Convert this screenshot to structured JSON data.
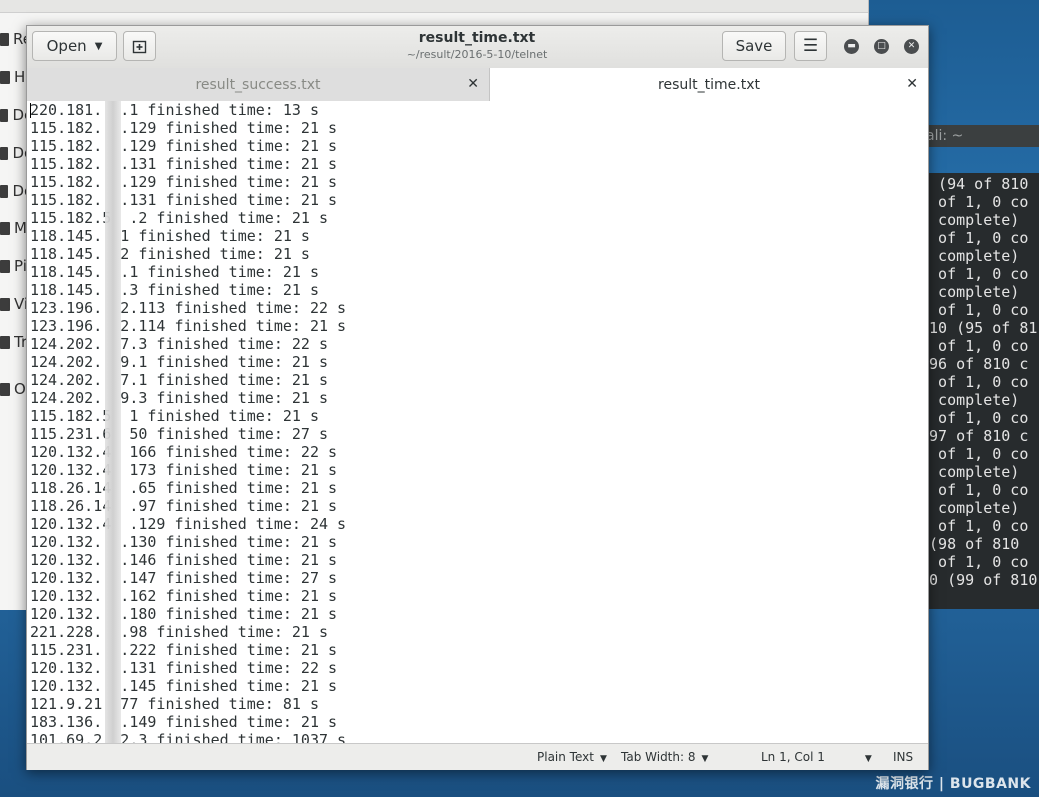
{
  "file_manager": {
    "sidebar_items": [
      {
        "label": "Re",
        "icon": "clock-icon"
      },
      {
        "label": "H",
        "icon": "home-icon"
      },
      {
        "label": "De",
        "icon": "desktop-icon"
      },
      {
        "label": "Do",
        "icon": "document-icon"
      },
      {
        "label": "Do",
        "icon": "download-icon"
      },
      {
        "label": "M",
        "icon": "music-icon"
      },
      {
        "label": "Pi",
        "icon": "picture-icon"
      },
      {
        "label": "Vi",
        "icon": "video-icon"
      },
      {
        "label": "Tr",
        "icon": "trash-icon"
      },
      {
        "label": "O",
        "icon": "plus-icon"
      }
    ]
  },
  "terminal": {
    "title": "ali: ~",
    "lines": [
      "4 (94 of 810",
      "1 of 1, 0 co",
      "0 complete)",
      "1 of 1, 0 co",
      "0 complete)",
      "1 of 1, 0 co",
      "0 complete)",
      "1 of 1, 0 co",
      "810 (95 of 81",
      "1 of 1, 0 co",
      "(96 of 810 c",
      "1 of 1, 0 co",
      "0 complete)",
      "1 of 1, 0 co",
      "(97 of 810 c",
      "1 of 1, 0 co",
      "0 complete)",
      "1 of 1, 0 co",
      "0 complete)",
      "1 of 1, 0 co",
      " (98 of 810",
      "1 of 1, 0 co",
      "20 (99 of 810"
    ]
  },
  "watermark": "漏洞银行 | BUGBANK",
  "gedit": {
    "open_label": "Open",
    "save_label": "Save",
    "title": "result_time.txt",
    "subtitle": "~/result/2016-5-10/telnet",
    "tabs": [
      {
        "label": "result_success.txt",
        "active": false
      },
      {
        "label": "result_time.txt",
        "active": true
      }
    ],
    "lines": [
      "220.181.  .1 finished time: 13 s",
      "115.182.  .129 finished time: 21 s",
      "115.182.  .129 finished time: 21 s",
      "115.182.  .131 finished time: 21 s",
      "115.182.  .129 finished time: 21 s",
      "115.182.  .131 finished time: 21 s",
      "115.182.5  .2 finished time: 21 s",
      "118.145.  1 finished time: 21 s",
      "118.145.  2 finished time: 21 s",
      "118.145.  .1 finished time: 21 s",
      "118.145.  .3 finished time: 21 s",
      "123.196.  2.113 finished time: 22 s",
      "123.196.  2.114 finished time: 21 s",
      "124.202.  7.3 finished time: 22 s",
      "124.202.  9.1 finished time: 21 s",
      "124.202.  7.1 finished time: 21 s",
      "124.202.  9.3 finished time: 21 s",
      "115.182.5  1 finished time: 21 s",
      "115.231.6  50 finished time: 27 s",
      "120.132.4  166 finished time: 22 s",
      "120.132.4  173 finished time: 21 s",
      "118.26.14  .65 finished time: 21 s",
      "118.26.14  .97 finished time: 21 s",
      "120.132.4  .129 finished time: 24 s",
      "120.132.  .130 finished time: 21 s",
      "120.132.  .146 finished time: 21 s",
      "120.132.  .147 finished time: 27 s",
      "120.132.  .162 finished time: 21 s",
      "120.132.  .180 finished time: 21 s",
      "221.228.  .98 finished time: 21 s",
      "115.231.  .222 finished time: 21 s",
      "120.132.  .131 finished time: 22 s",
      "120.132.  .145 finished time: 21 s",
      "121.9.21  77 finished time: 81 s",
      "183.136.  .149 finished time: 21 s",
      "101.69.2  2.3 finished time: 1037 s"
    ],
    "status": {
      "language": "Plain Text",
      "tab_width": "Tab Width: 8",
      "position": "Ln 1, Col 1",
      "mode": "INS"
    }
  }
}
